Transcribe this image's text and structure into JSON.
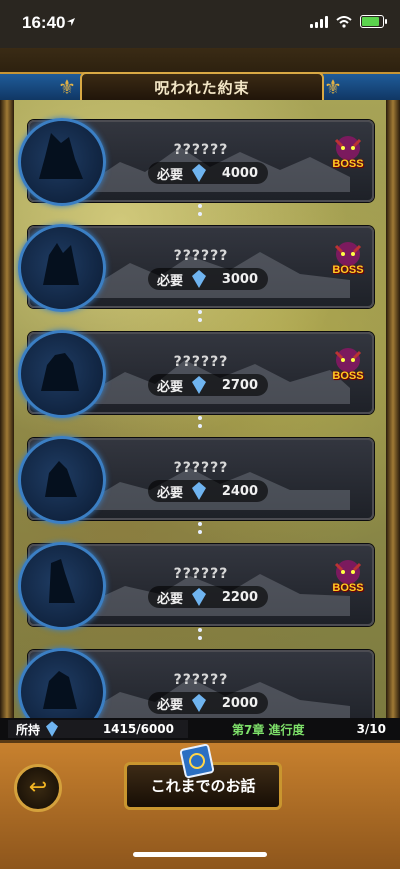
{
  "status_bar": {
    "time": "16:40"
  },
  "header": {
    "title": "呪われた約束"
  },
  "chapters": [
    {
      "name": "??????",
      "req_label": "必要",
      "req_value": "4000",
      "boss": true,
      "boss_label": "BOSS"
    },
    {
      "name": "??????",
      "req_label": "必要",
      "req_value": "3000",
      "boss": true,
      "boss_label": "BOSS"
    },
    {
      "name": "??????",
      "req_label": "必要",
      "req_value": "2700",
      "boss": true,
      "boss_label": "BOSS"
    },
    {
      "name": "??????",
      "req_label": "必要",
      "req_value": "2400",
      "boss": false,
      "boss_label": ""
    },
    {
      "name": "??????",
      "req_label": "必要",
      "req_value": "2200",
      "boss": true,
      "boss_label": "BOSS"
    },
    {
      "name": "??????",
      "req_label": "必要",
      "req_value": "2000",
      "boss": false,
      "boss_label": ""
    }
  ],
  "footer": {
    "owned_label": "所持",
    "owned_value": "1415/6000",
    "progress_label": "第7章 進行度",
    "progress_value": "3/10",
    "story_button_label": "これまでのお話"
  },
  "colors": {
    "accent": "#d9a944",
    "blue": "#3b7fc4",
    "boss": "#ffcc22"
  },
  "icons": [
    "location-arrow-icon",
    "signal-icon",
    "wifi-icon",
    "battery-icon",
    "crystal-icon",
    "boss-demon-icon",
    "back-arrow-icon",
    "book-icon"
  ]
}
